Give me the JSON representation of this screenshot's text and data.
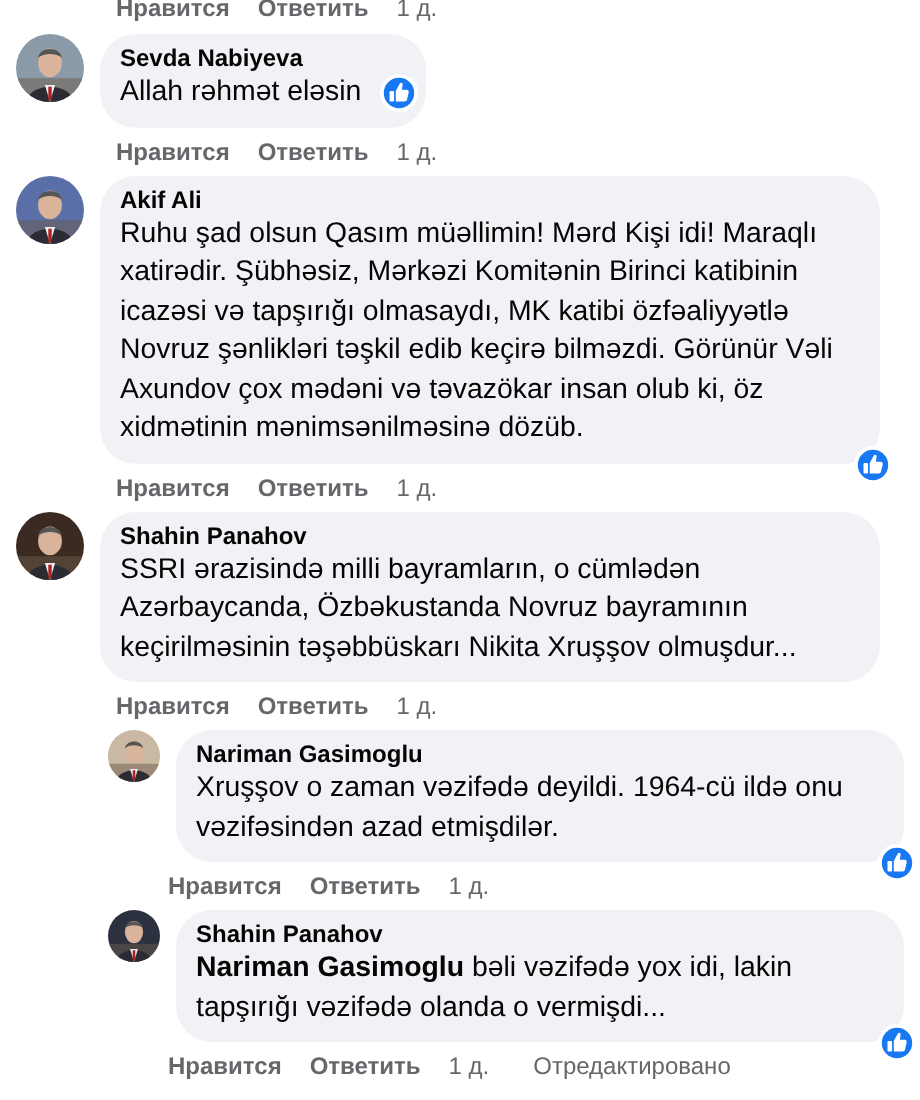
{
  "top_actions": {
    "like": "Нравится",
    "reply": "Ответить",
    "time": "1 д."
  },
  "comments": [
    {
      "author": "Sevda Nabiyeva",
      "text": "Allah rəhmət eləsin",
      "liked": true,
      "actions": {
        "like": "Нравится",
        "reply": "Ответить",
        "time": "1 д."
      }
    },
    {
      "author": "Akif Ali",
      "text": "Ruhu şad olsun Qasım müəllimin! Mərd Kişi idi! Maraqlı xatirədir. Şübhəsiz, Mərkəzi Komitənin Birinci katibinin icazəsi və tapşırığı olmasaydı, MK katibi özfəaliyyətlə Novruz şənlikləri təşkil edib keçirə bilməzdi. Görünür Vəli Axundov çox mədəni və təvazökar insan olub ki, öz xidmətinin mənimsənilməsinə dözüb.",
      "liked": true,
      "actions": {
        "like": "Нравится",
        "reply": "Ответить",
        "time": "1 д."
      }
    },
    {
      "author": "Shahin Panahov",
      "text": "SSRI ərazisində milli bayramların, o cümlədən Azərbaycanda, Özbəkustanda Novruz bayramının keçirilməsinin təşəbbüskarı Nikita Xruşşov olmuşdur...",
      "liked": false,
      "actions": {
        "like": "Нравится",
        "reply": "Ответить",
        "time": "1 д."
      },
      "replies": [
        {
          "author": "Nariman Gasimoglu",
          "text": "Xruşşov o zaman vəzifədə deyildi. 1964-cü ildə onu vəzifəsindən azad etmişdilər.",
          "liked": true,
          "actions": {
            "like": "Нравится",
            "reply": "Ответить",
            "time": "1 д."
          }
        },
        {
          "author": "Shahin Panahov",
          "text": "**Nariman Gasimoglu** bəli vəzifədə yox idi, lakin tapşırığı vəzifədə olanda o vermişdi...",
          "liked": true,
          "actions": {
            "like": "Нравится",
            "reply": "Ответить",
            "time": "1 д.",
            "edited": "Отредактировано"
          }
        }
      ]
    }
  ]
}
